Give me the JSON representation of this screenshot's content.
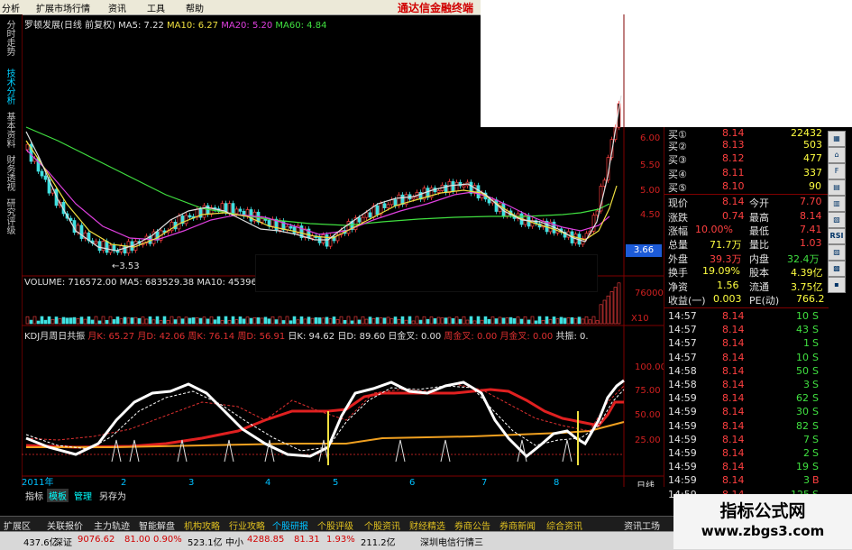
{
  "menu": {
    "items": [
      "分析",
      "扩展市场行情",
      "资讯",
      "工具",
      "帮助"
    ],
    "brand": "通达信金融终端"
  },
  "side_tabs": [
    "分时走势",
    "技术分析",
    "基本资料",
    "财务透视",
    "研究评级"
  ],
  "chart": {
    "stock_name": "罗顿发展(日线 前复权)",
    "ma": [
      {
        "label": "MA5: 7.22",
        "color": "#e0e0e0"
      },
      {
        "label": "MA10: 6.27",
        "color": "#f0e040"
      },
      {
        "label": "MA20: 5.20",
        "color": "#e040e0"
      },
      {
        "label": "MA60: 4.84",
        "color": "#40e040"
      }
    ],
    "low_annotation": "←3.53",
    "volume_title": "VOLUME: 716572.00  MA5: 683529.38  MA10: 45396",
    "kdj_title": [
      {
        "text": "KDJ月周日共振",
        "color": "#e0e0e0"
      },
      {
        "text": "月K: 65.27",
        "color": "#e03030"
      },
      {
        "text": "月D: 42.06",
        "color": "#e03030"
      },
      {
        "text": "周K: 76.14",
        "color": "#e03030"
      },
      {
        "text": "周D: 56.91",
        "color": "#e03030"
      },
      {
        "text": "日K: 94.62",
        "color": "#e0e0e0"
      },
      {
        "text": "日D: 89.60",
        "color": "#e0e0e0"
      },
      {
        "text": "日金叉: 0.00",
        "color": "#e0e0e0"
      },
      {
        "text": "周金叉: 0.00",
        "color": "#e03030"
      },
      {
        "text": "月金叉: 0.00",
        "color": "#e03030"
      },
      {
        "text": "共振: 0.",
        "color": "#e0e0e0"
      }
    ],
    "price_axis": [
      "6.00",
      "5.50",
      "5.00",
      "4.50",
      "4.00"
    ],
    "current_price_marker": "3.66",
    "volume_axis": [
      "76000",
      "X10"
    ],
    "kdj_axis": [
      "100.00",
      "75.00",
      "50.00",
      "25.00"
    ],
    "timescale": [
      "2011年",
      "2",
      "3",
      "4",
      "5",
      "6",
      "7",
      "8"
    ],
    "period": "日线"
  },
  "bottom_tabs": [
    "指标",
    "模板",
    "管理",
    "另存为"
  ],
  "quotes": {
    "bids": [
      {
        "label": "买①",
        "price": "8.14",
        "vol": "22432"
      },
      {
        "label": "买②",
        "price": "8.13",
        "vol": "503"
      },
      {
        "label": "买③",
        "price": "8.12",
        "vol": "477"
      },
      {
        "label": "买④",
        "price": "8.11",
        "vol": "337"
      },
      {
        "label": "买⑤",
        "price": "8.10",
        "vol": "90"
      }
    ],
    "stats": [
      {
        "l1": "现价",
        "v1": "8.14",
        "l2": "今开",
        "v2": "7.70"
      },
      {
        "l1": "涨跌",
        "v1": "0.74",
        "l2": "最高",
        "v2": "8.14"
      },
      {
        "l1": "涨幅",
        "v1": "10.00%",
        "l2": "最低",
        "v2": "7.41"
      },
      {
        "l1": "总量",
        "v1": "71.7万",
        "l2": "量比",
        "v2": "1.03"
      },
      {
        "l1": "外盘",
        "v1": "39.3万",
        "l2": "内盘",
        "v2": "32.4万"
      },
      {
        "l1": "换手",
        "v1": "19.09%",
        "l2": "股本",
        "v2": "4.39亿"
      },
      {
        "l1": "净资",
        "v1": "1.56",
        "l2": "流通",
        "v2": "3.75亿"
      },
      {
        "l1": "收益(一)",
        "v1": "0.003",
        "l2": "PE(动)",
        "v2": "766.2"
      }
    ],
    "ticks": [
      {
        "time": "14:57",
        "price": "8.14",
        "vol": "10",
        "dir": "S"
      },
      {
        "time": "14:57",
        "price": "8.14",
        "vol": "43",
        "dir": "S"
      },
      {
        "time": "14:57",
        "price": "8.14",
        "vol": "1",
        "dir": "S"
      },
      {
        "time": "14:57",
        "price": "8.14",
        "vol": "10",
        "dir": "S"
      },
      {
        "time": "14:58",
        "price": "8.14",
        "vol": "50",
        "dir": "S"
      },
      {
        "time": "14:58",
        "price": "8.14",
        "vol": "3",
        "dir": "S"
      },
      {
        "time": "14:59",
        "price": "8.14",
        "vol": "62",
        "dir": "S"
      },
      {
        "time": "14:59",
        "price": "8.14",
        "vol": "30",
        "dir": "S"
      },
      {
        "time": "14:59",
        "price": "8.14",
        "vol": "82",
        "dir": "S"
      },
      {
        "time": "14:59",
        "price": "8.14",
        "vol": "7",
        "dir": "S"
      },
      {
        "time": "14:59",
        "price": "8.14",
        "vol": "2",
        "dir": "S"
      },
      {
        "time": "14:59",
        "price": "8.14",
        "vol": "19",
        "dir": "S"
      },
      {
        "time": "14:59",
        "price": "8.14",
        "vol": "3",
        "dir": "B"
      },
      {
        "time": "14:59",
        "price": "8.14",
        "vol": "125",
        "dir": "S"
      }
    ],
    "right_icons": [
      "",
      "",
      "",
      "",
      "RSI",
      "",
      "",
      "",
      "",
      ""
    ]
  },
  "function_bar": [
    {
      "text": "扩展区",
      "color": "#e0e0e0"
    },
    {
      "text": "关联报价",
      "color": "#e0e0e0"
    },
    {
      "text": "主力轨迹",
      "color": "#e0e0e0"
    },
    {
      "text": "智能解盘",
      "color": "#e0e0e0"
    },
    {
      "text": "机构攻略",
      "color": "#e0c020"
    },
    {
      "text": "行业攻略",
      "color": "#e0c020"
    },
    {
      "text": "个股研报",
      "color": "#00c0ff"
    },
    {
      "text": "个股评级",
      "color": "#e0c020"
    },
    {
      "text": "个股资讯",
      "color": "#e0c020"
    },
    {
      "text": "财经精选",
      "color": "#e0c020"
    },
    {
      "text": "券商公告",
      "color": "#e0c020"
    },
    {
      "text": "券商新闻",
      "color": "#e0c020"
    },
    {
      "text": "综合资讯",
      "color": "#e0c020"
    },
    {
      "text": "资讯工场",
      "color": "#e0e0e0"
    }
  ],
  "status_bar": [
    {
      "text": "437.6亿",
      "color": "#000"
    },
    {
      "text": "深证",
      "color": "#000"
    },
    {
      "text": "9076.62",
      "color": "#d00000"
    },
    {
      "text": "81.00",
      "color": "#d00000"
    },
    {
      "text": "0.90%",
      "color": "#d00000"
    },
    {
      "text": "523.1亿",
      "color": "#000"
    },
    {
      "text": "中小",
      "color": "#000"
    },
    {
      "text": "4288.85",
      "color": "#d00000"
    },
    {
      "text": "81.31",
      "color": "#d00000"
    },
    {
      "text": "1.93%",
      "color": "#d00000"
    },
    {
      "text": "211.2亿",
      "color": "#000"
    },
    {
      "text": "深圳电信行情三",
      "color": "#000"
    }
  ],
  "watermark": {
    "title": "指标公式网",
    "url": "www.zbgs3.com"
  }
}
